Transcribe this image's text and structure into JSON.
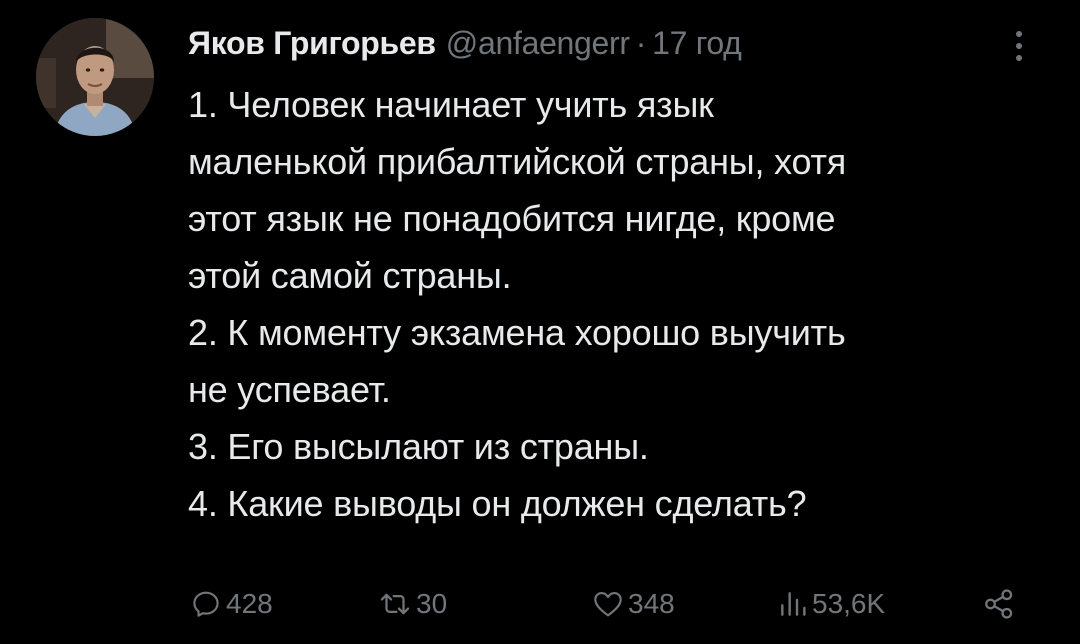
{
  "author": {
    "name": "Яков Григорьев",
    "handle": "@anfaengerr",
    "separator": "·",
    "time": "17 год"
  },
  "tweet": {
    "lines": [
      "1. Человек начинает учить язык",
      "маленькой прибалтийской страны, хотя",
      "этот язык не понадобится нигде, кроме",
      "этой самой страны.",
      "2. К моменту экзамена хорошо выучить",
      "не успевает.",
      "3. Его высылают из страны.",
      "4. Какие выводы он должен сделать?"
    ]
  },
  "actions": {
    "replies": "428",
    "retweets": "30",
    "likes": "348",
    "views": "53,6K"
  },
  "icons": {
    "more": "more-vertical-icon",
    "reply": "reply-icon",
    "retweet": "retweet-icon",
    "like": "heart-icon",
    "views": "views-icon",
    "share": "share-icon"
  },
  "colors": {
    "background": "#000000",
    "text": "#e7e9ea",
    "muted": "#71767b"
  }
}
